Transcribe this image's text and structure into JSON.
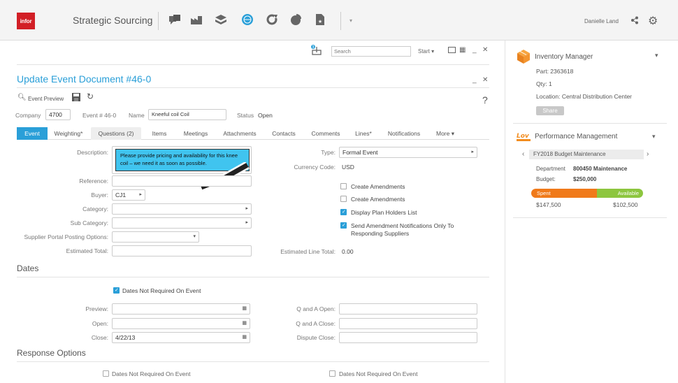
{
  "topbar": {
    "logo": "infor",
    "app_title": "Strategic Sourcing",
    "user_name": "Danielle Land",
    "icons": [
      "chat-icon",
      "factory-icon",
      "dropbox-icon",
      "globe-icon",
      "refresh-icon",
      "pie-chart-icon",
      "document-star-icon"
    ]
  },
  "toolbar": {
    "search_placeholder": "Search",
    "start_label": "Start"
  },
  "document": {
    "title": "Update Event Document #46-0",
    "event_preview_label": "Event Preview",
    "help_label": "?",
    "company_label": "Company",
    "company_value": "4700",
    "event_num": "Event # 46-0",
    "name_label": "Name",
    "name_value": "Kneeful coil Coil",
    "status_label": "Status",
    "status_value": "Open"
  },
  "tabs": [
    {
      "label": "Event"
    },
    {
      "label": "Weighting*"
    },
    {
      "label": "Questions (2)"
    },
    {
      "label": "Items"
    },
    {
      "label": "Meetings"
    },
    {
      "label": "Attachments"
    },
    {
      "label": "Contacts"
    },
    {
      "label": "Comments"
    },
    {
      "label": "Lines*"
    },
    {
      "label": "Notifications"
    },
    {
      "label": "More ▾"
    }
  ],
  "form_left": {
    "description_label": "Description:",
    "description_value": "Please provide pricing and availability for this knee coil – we need it as soon as possible.",
    "reference_label": "Reference:",
    "buyer_label": "Buyer:",
    "buyer_value": "CJ1",
    "category_label": "Category:",
    "subcategory_label": "Sub Category:",
    "portal_label": "Supplier Portal Posting Options:",
    "estimated_total_label": "Estimated Total:"
  },
  "form_right": {
    "type_label": "Type:",
    "type_value": "Formal Event",
    "currency_label": "Currency Code:",
    "currency_value": "USD",
    "cb_create_amend_1": "Create Amendments",
    "cb_create_amend_2": "Create Amendments",
    "cb_display_plan": "Display Plan Holders List",
    "cb_send_amend": "Send Amendment Notifications Only To Responding Suppliers",
    "est_line_total_label": "Estimated Line Total:",
    "est_line_total_value": "0.00"
  },
  "dates": {
    "section_title": "Dates",
    "dates_not_required": "Dates Not Required On Event",
    "preview_label": "Preview:",
    "open_label": "Open:",
    "close_label": "Close:",
    "close_value": "4/22/13",
    "qa_open_label": "Q and A Open:",
    "qa_close_label": "Q and A Close:",
    "dispute_close_label": "Dispute Close:"
  },
  "response": {
    "section_title": "Response Options",
    "cb_left": "Dates Not Required On Event",
    "cb_right": "Dates Not Required On Event"
  },
  "inventory": {
    "title": "Inventory Manager",
    "part": "Part: 2363618",
    "qty": "Qty: 1",
    "location": "Location: Central Distribution Center",
    "share_label": "Share"
  },
  "performance": {
    "title": "Performance Management",
    "budget_name": "FY2018 Budget Maintenance",
    "department_label": "Department",
    "department_value": "800450 Maintenance",
    "budget_label": "Budget:",
    "budget_value": "$250,000",
    "spent_label": "Spent",
    "available_label": "Available",
    "spent_value": "$147,500",
    "available_value": "$102,500",
    "spent_fraction": 0.59,
    "spent_color": "#f07a1a",
    "available_color": "#8dc63f"
  },
  "colors": {
    "accent": "#2a9fd8",
    "brand": "#d21f26"
  }
}
